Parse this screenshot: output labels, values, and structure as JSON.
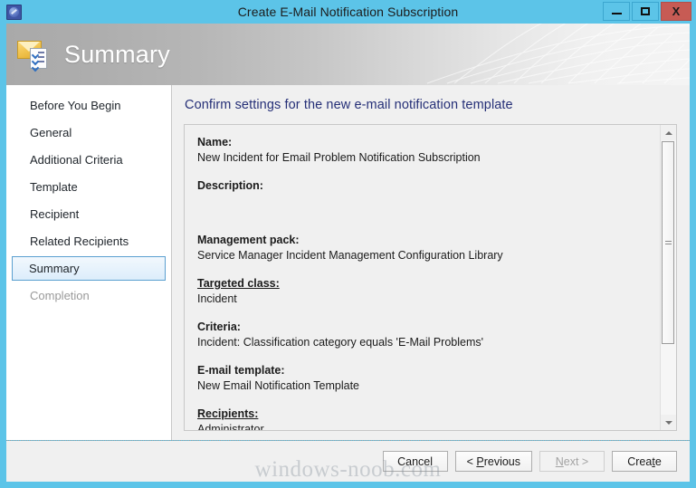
{
  "window": {
    "title": "Create E-Mail Notification Subscription",
    "title_icon": "subscription-icon",
    "accent_color": "#5cc4e8",
    "close_color": "#c75b54",
    "controls": {
      "minimize": "–",
      "maximize": "□",
      "close": "X"
    }
  },
  "banner": {
    "title": "Summary",
    "icon": "envelope-checklist-icon"
  },
  "nav": {
    "items": [
      {
        "label": "Before You Begin",
        "state": "normal"
      },
      {
        "label": "General",
        "state": "normal"
      },
      {
        "label": "Additional Criteria",
        "state": "normal"
      },
      {
        "label": "Template",
        "state": "normal"
      },
      {
        "label": "Recipient",
        "state": "normal"
      },
      {
        "label": "Related Recipients",
        "state": "normal"
      },
      {
        "label": "Summary",
        "state": "selected"
      },
      {
        "label": "Completion",
        "state": "disabled"
      }
    ]
  },
  "main": {
    "heading": "Confirm settings for the new e-mail notification template",
    "heading_color": "#252f77",
    "summary": [
      {
        "label": "Name:",
        "value": "New Incident for Email Problem Notification Subscription",
        "underline": false
      },
      {
        "label": "Description:",
        "value": "",
        "underline": false
      },
      {
        "label": "Management pack:",
        "value": "Service Manager Incident Management Configuration Library",
        "underline": false
      },
      {
        "label": "Targeted class:",
        "value": "Incident",
        "underline": true
      },
      {
        "label": "Criteria:",
        "value": "Incident: Classification category equals 'E-Mail Problems'",
        "underline": false
      },
      {
        "label": "E-mail template:",
        "value": "New Email Notification Template",
        "underline": false
      },
      {
        "label": "Recipients:",
        "value": "Administrator",
        "underline": true
      }
    ],
    "scrollbar": {
      "up_arrow": "scroll-up-arrow",
      "down_arrow": "scroll-down-arrow",
      "thumb_position_percent": 0
    }
  },
  "footer": {
    "buttons": [
      {
        "label": "Cancel",
        "accesskey": "",
        "disabled": false
      },
      {
        "label": "< Previous",
        "accesskey": "P",
        "disabled": false
      },
      {
        "label": "Next >",
        "accesskey": "N",
        "disabled": true
      },
      {
        "label": "Create",
        "accesskey": "t",
        "disabled": false
      }
    ]
  },
  "watermark": "windows-noob.com"
}
